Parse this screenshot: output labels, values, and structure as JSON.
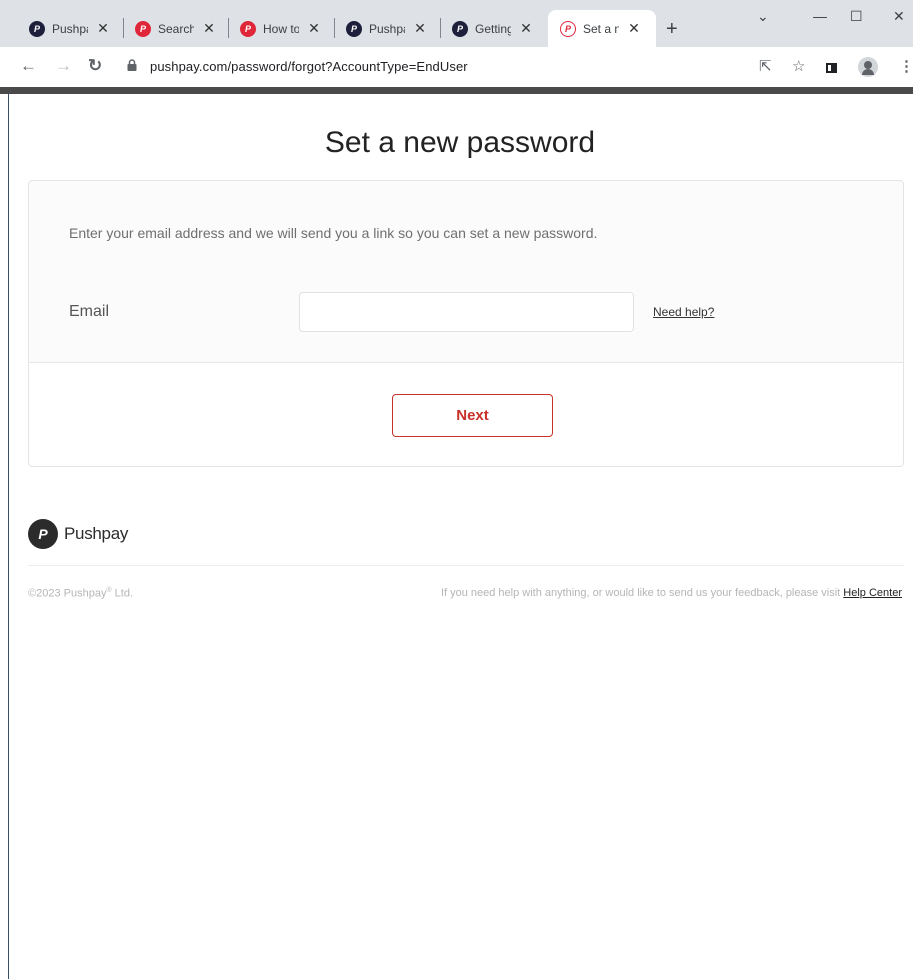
{
  "browser": {
    "tabs": [
      {
        "label": "Pushpay",
        "favicon": "pushpay-dark"
      },
      {
        "label": "Search",
        "favicon": "pushpay-red"
      },
      {
        "label": "How to",
        "favicon": "pushpay-red"
      },
      {
        "label": "Pushpay",
        "favicon": "pushpay-dark"
      },
      {
        "label": "Getting",
        "favicon": "pushpay-dark"
      },
      {
        "label": "Set a ne",
        "favicon": "pushpay-outline",
        "active": true
      }
    ],
    "tab_close": "✕",
    "new_tab": "+",
    "url": "pushpay.com/password/forgot?AccountType=EndUser"
  },
  "page": {
    "title": "Set a new password",
    "intro": "Enter your email address and we will send you a link so you can set a new password.",
    "email_label": "Email",
    "email_value": "",
    "need_help": "Need help?",
    "next_button": "Next"
  },
  "footer": {
    "logo_text": "Pushpay",
    "copyright_prefix": "©2023 Pushpay",
    "copyright_reg": "®",
    "copyright_suffix": " Ltd.",
    "help_text": "If you need help with anything, or would like to send us your feedback, please visit ",
    "help_link": "Help Center"
  },
  "colors": {
    "accent": "#c8312a",
    "brand_dark": "#1e1f3b",
    "brand_red": "#e0273a"
  }
}
